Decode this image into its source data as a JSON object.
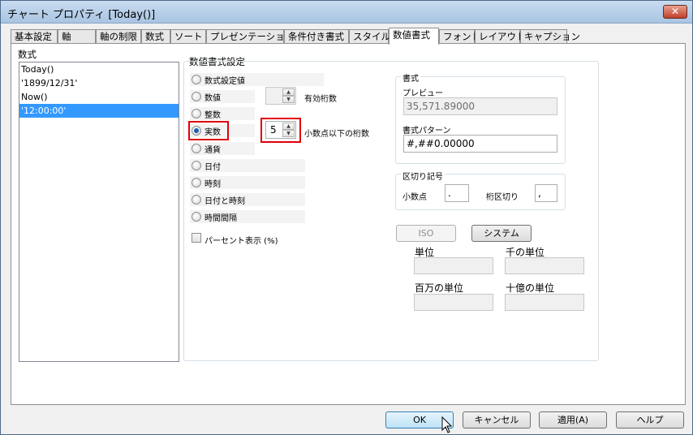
{
  "window": {
    "title": "チャート プロパティ [Today()]",
    "close_glyph": "✕"
  },
  "tabs": [
    "基本設定",
    "軸",
    "軸の制限",
    "数式",
    "ソート",
    "プレゼンテーション",
    "条件付き書式",
    "スタイル",
    "数値書式",
    "フォント",
    "レイアウト",
    "キャプション"
  ],
  "formulas": {
    "label": "数式",
    "items": [
      "Today()",
      "'1899/12/31'",
      "Now()",
      "'12:00:00'"
    ],
    "selected_index": 3
  },
  "number_format": {
    "group_label": "数値書式設定",
    "options": [
      "数式設定値",
      "数値",
      "整数",
      "実数",
      "通貨",
      "日付",
      "時刻",
      "日付と時刻",
      "時間間隔"
    ],
    "selected_option": "実数",
    "significant_digits_label": "有効桁数",
    "decimals_label": "小数点以下の桁数",
    "decimals_value": "5",
    "percent_label": "パーセント表示 (%)",
    "percent_checked": false
  },
  "format": {
    "group_label": "書式",
    "preview_label": "プレビュー",
    "preview_value": "35,571.89000",
    "pattern_label": "書式パターン",
    "pattern_value": "#,##0.00000"
  },
  "separators": {
    "group_label": "区切り記号",
    "decimal_label": "小数点",
    "decimal_value": ".",
    "thousand_label": "桁区切り",
    "thousand_value": ","
  },
  "unit_buttons": {
    "iso": "ISO",
    "system": "システム"
  },
  "units": {
    "unit": "単位",
    "thousand": "千の単位",
    "million": "百万の単位",
    "billion": "十億の単位"
  },
  "footer": {
    "ok": "OK",
    "cancel": "キャンセル",
    "apply": "適用(A)",
    "help": "ヘルプ"
  },
  "colors": {
    "selection": "#3399ff",
    "highlight_box": "#e0000a"
  }
}
